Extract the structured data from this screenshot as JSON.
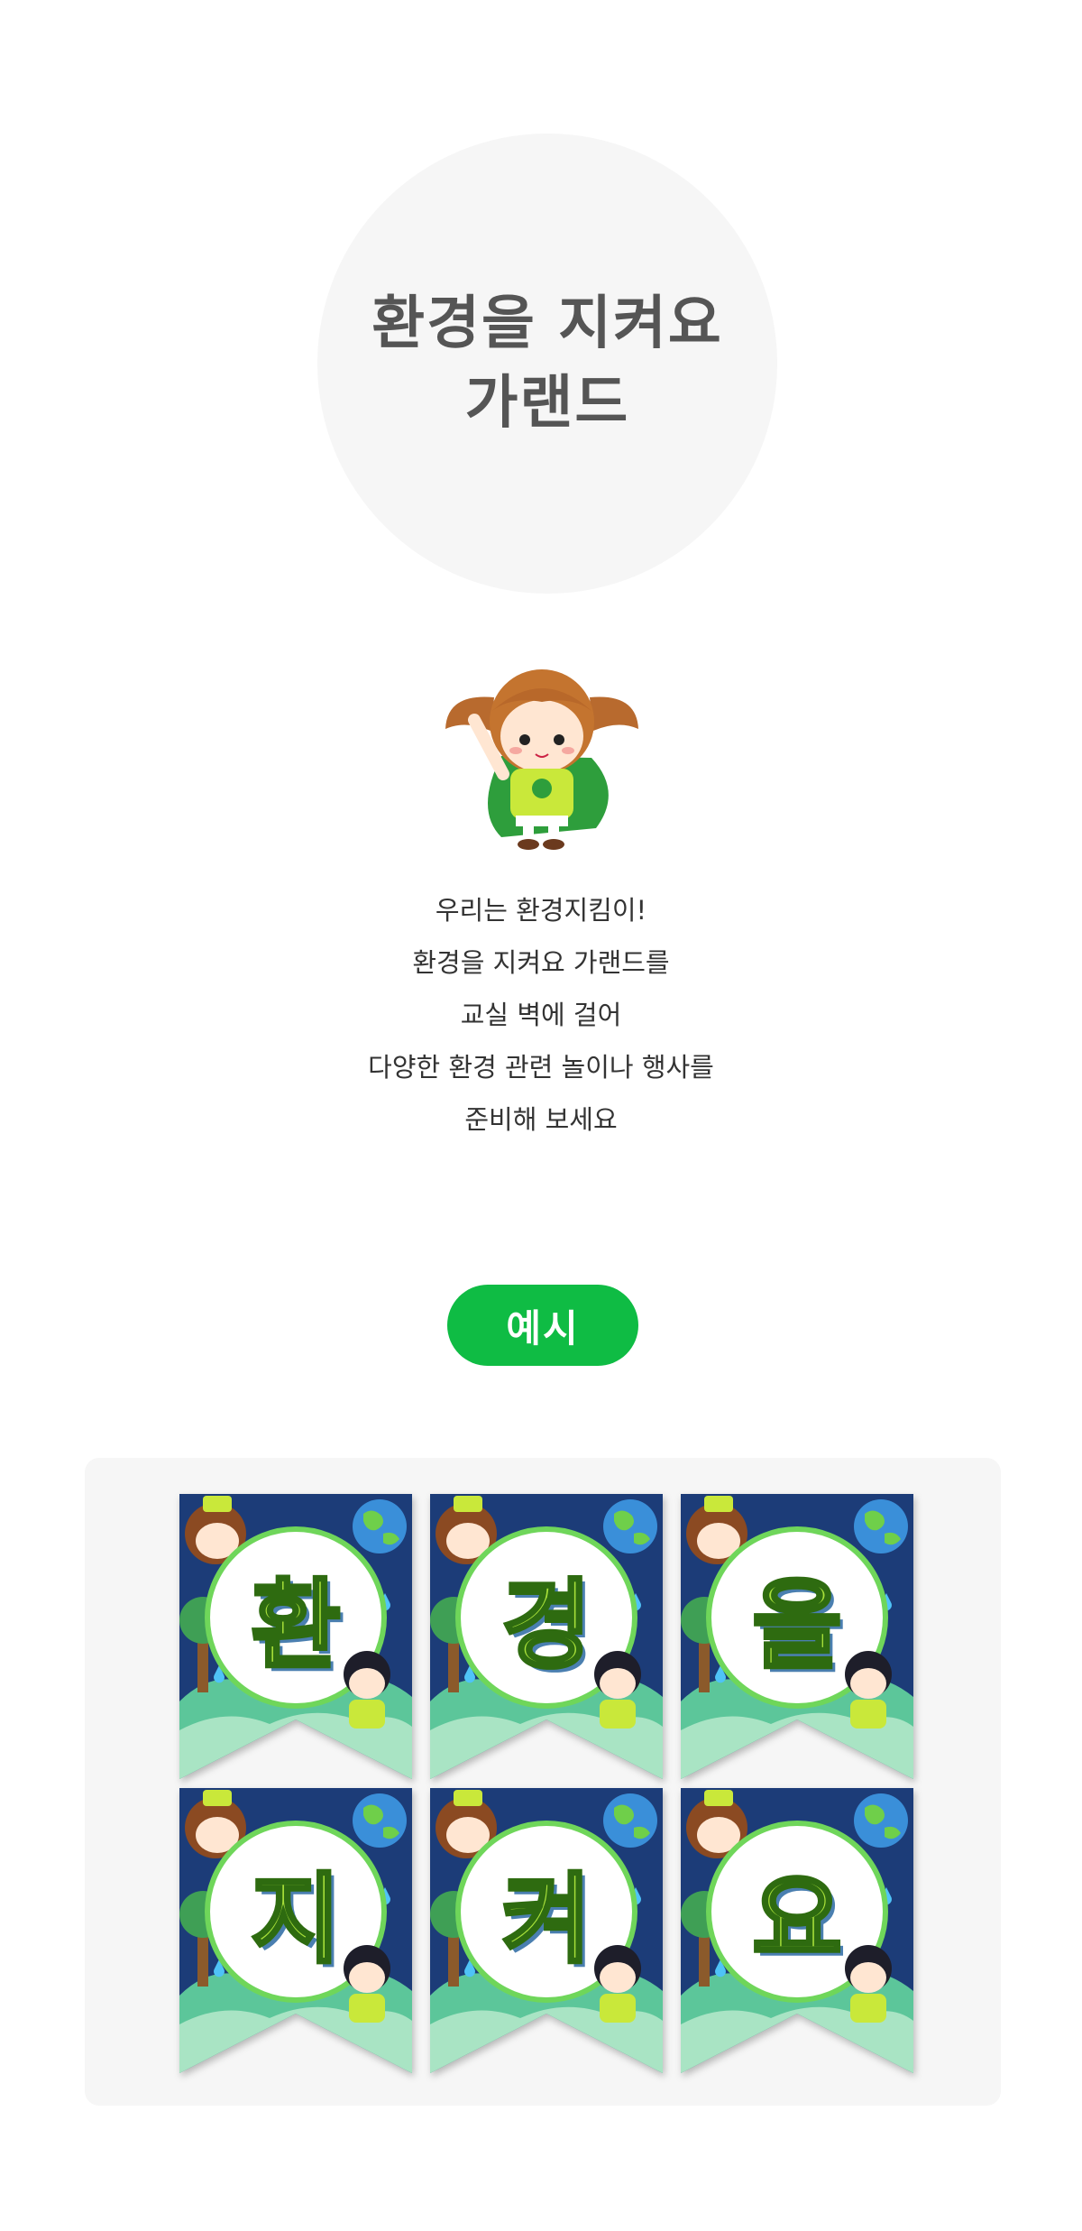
{
  "title": {
    "line1": "환경을 지켜요",
    "line2": "가랜드"
  },
  "description": [
    "우리는 환경지킴이!",
    "환경을 지켜요 가랜드를",
    "교실 벽에 걸어",
    "다양한 환경 관련 놀이나 행사를",
    "준비해 보세요"
  ],
  "example_label": "예시",
  "garland": {
    "letters": [
      "환",
      "경",
      "을",
      "지",
      "켜",
      "요"
    ]
  },
  "colors": {
    "title_bg": "#f6f6f6",
    "title_text": "#555555",
    "accent_green": "#0fbc44",
    "flag_navy": "#1c3c78",
    "letter_fill": "#a8e03a"
  },
  "icons": {
    "mascot": "eco-girl-mascot-illustration",
    "flag_globe": "globe-icon",
    "flag_boy": "eco-boy-illustration",
    "flag_girl": "eco-girl-illustration"
  }
}
